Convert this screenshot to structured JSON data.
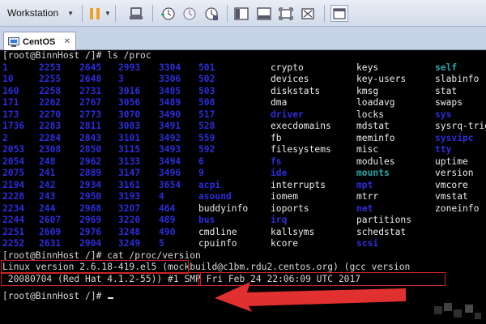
{
  "toolbar": {
    "workstation_label": "Workstation",
    "accent": "#f0a020"
  },
  "tab": {
    "label": "CentOS"
  },
  "terminal": {
    "lines": {
      "l0": "[root@BinnHost /]# ls /proc",
      "l19": "[root@BinnHost /]# cat /proc/version",
      "l20": "Linux version 2.6.18-419.el5 (mockbuild@c1bm.rdu2.centos.org) (gcc version",
      "l21": " 20080704 (Red Hat 4.1.2-55)) #1 SMP Fri Feb 24 22:06:09 UTC 2017",
      "l22": "[root@BinnHost /]# "
    },
    "proc_columns": [
      [
        "1",
        "10",
        "160",
        "171",
        "173",
        "1736",
        "2",
        "2053",
        "2054",
        "2075",
        "2194",
        "2228",
        "2234",
        "2244",
        "2251",
        "2252"
      ],
      [
        "2253",
        "2255",
        "2258",
        "2262",
        "2270",
        "2283",
        "2284",
        "2308",
        "248",
        "241",
        "242",
        "243",
        "244",
        "2607",
        "2609",
        "2631"
      ],
      [
        "2645",
        "2648",
        "2731",
        "2767",
        "2773",
        "2811",
        "2843",
        "2850",
        "2962",
        "2889",
        "2934",
        "2950",
        "2968",
        "2969",
        "2976",
        "2904"
      ],
      [
        "2993",
        "3",
        "3016",
        "3056",
        "3070",
        "3083",
        "3101",
        "3115",
        "3133",
        "3147",
        "3161",
        "3193",
        "3207",
        "3220",
        "3248",
        "3249"
      ],
      [
        "3304",
        "3306",
        "3485",
        "3489",
        "3490",
        "3491",
        "3492",
        "3493",
        "3494",
        "3496",
        "3654",
        "4",
        "464",
        "489",
        "490",
        "5"
      ],
      [
        "501",
        "502",
        "503",
        "508",
        "517",
        "528",
        "559",
        "592",
        "6",
        "9",
        "acpi",
        "asound",
        "buddyinfo",
        "bus",
        "cmdline",
        "cpuinfo"
      ],
      [
        "crypto",
        "devices",
        "diskstats",
        "dma",
        "driver",
        "execdomains",
        "fb",
        "filesystems",
        "fs",
        "ide",
        "interrupts",
        "iomem",
        "ioports",
        "irq",
        "kallsyms",
        "kcore"
      ],
      [
        "keys",
        "key-users",
        "kmsg",
        "loadavg",
        "locks",
        "mdstat",
        "meminfo",
        "misc",
        "modules",
        "mounts",
        "mpt",
        "mtrr",
        "net",
        "partitions",
        "schedstat",
        "scsi"
      ],
      [
        "self",
        "slabinfo",
        "stat",
        "swaps",
        "sys",
        "sysrq-trigger",
        "sysvipc",
        "tty",
        "uptime",
        "version",
        "vmcore",
        "vmstat",
        "zoneinfo",
        "",
        "",
        ""
      ]
    ],
    "proc_colors": [
      [
        "b",
        "b",
        "b",
        "b",
        "b",
        "b",
        "b",
        "b",
        "b",
        "b",
        "b",
        "b",
        "b",
        "b",
        "b",
        "b"
      ],
      [
        "b",
        "b",
        "b",
        "b",
        "b",
        "b",
        "b",
        "b",
        "b",
        "b",
        "b",
        "b",
        "b",
        "b",
        "b",
        "b"
      ],
      [
        "b",
        "b",
        "b",
        "b",
        "b",
        "b",
        "b",
        "b",
        "b",
        "b",
        "b",
        "b",
        "b",
        "b",
        "b",
        "b"
      ],
      [
        "b",
        "b",
        "b",
        "b",
        "b",
        "b",
        "b",
        "b",
        "b",
        "b",
        "b",
        "b",
        "b",
        "b",
        "b",
        "b"
      ],
      [
        "b",
        "b",
        "b",
        "b",
        "b",
        "b",
        "b",
        "b",
        "b",
        "b",
        "b",
        "b",
        "b",
        "b",
        "b",
        "b"
      ],
      [
        "b",
        "b",
        "b",
        "b",
        "b",
        "b",
        "b",
        "b",
        "b",
        "b",
        "b",
        "b",
        "w",
        "b",
        "w",
        "w"
      ],
      [
        "w",
        "w",
        "w",
        "w",
        "b",
        "w",
        "w",
        "w",
        "b",
        "b",
        "w",
        "w",
        "w",
        "b",
        "w",
        "w"
      ],
      [
        "w",
        "w",
        "w",
        "w",
        "w",
        "w",
        "w",
        "w",
        "w",
        "c",
        "b",
        "w",
        "b",
        "w",
        "w",
        "b"
      ],
      [
        "c",
        "w",
        "w",
        "w",
        "b",
        "w",
        "b",
        "b",
        "w",
        "w",
        "w",
        "w",
        "w",
        "",
        "",
        ""
      ]
    ],
    "colors": {
      "dir_blue": "#2d2ddb",
      "file_white": "#ececec",
      "link_cyan": "#2aa8a8",
      "highlight_red": "#d02424"
    }
  }
}
